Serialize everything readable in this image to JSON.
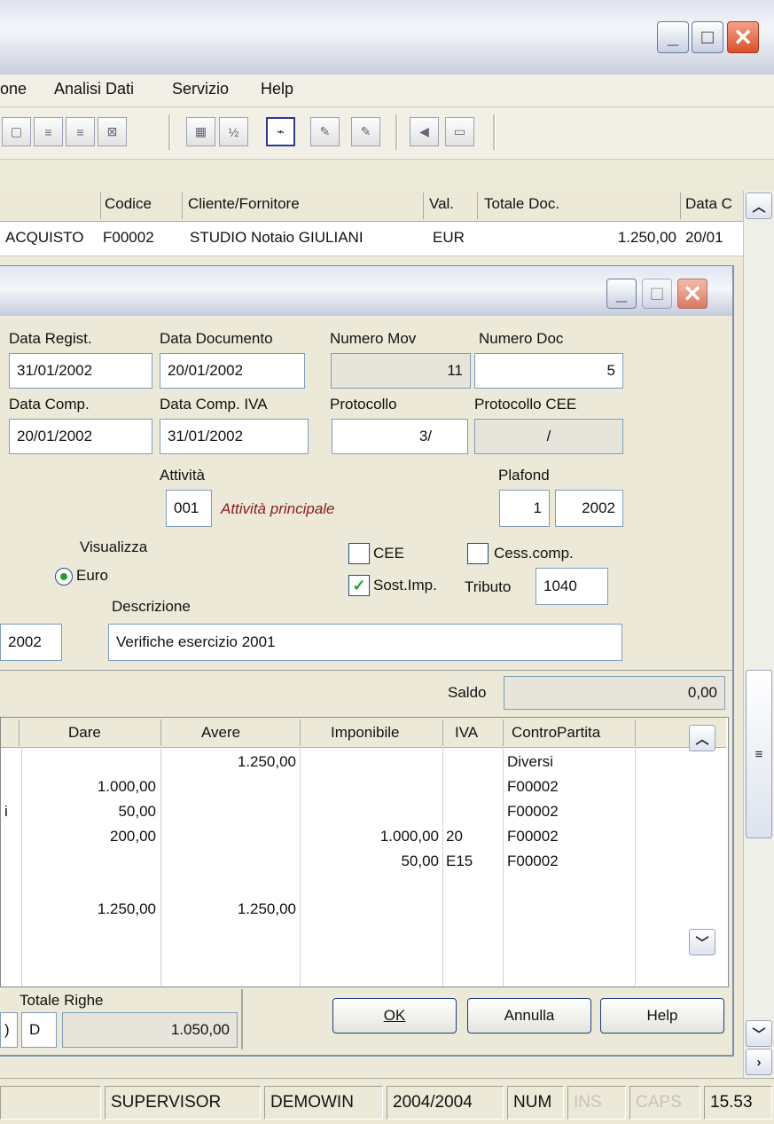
{
  "window": {
    "minimize": "_",
    "maximize": "□",
    "close": "✕"
  },
  "menu": [
    "one",
    "Analisi Dati",
    "Servizio",
    "Help"
  ],
  "grid": {
    "headers": [
      "Codice",
      "Cliente/Fornitore",
      "Val.",
      "Totale Doc.",
      "Data C"
    ],
    "row": {
      "tipo": "ACQUISTO",
      "codice": "F00002",
      "cliente": "STUDIO Notaio GIULIANI",
      "val": "EUR",
      "totale": "1.250,00",
      "data": "20/01"
    }
  },
  "dialog": {
    "labels": {
      "data_regist": "Data Regist.",
      "data_documento": "Data Documento",
      "numero_mov": "Numero Mov",
      "numero_doc": "Numero Doc",
      "data_comp": "Data Comp.",
      "data_comp_iva": "Data Comp. IVA",
      "protocollo": "Protocollo",
      "protocollo_cee": "Protocollo CEE",
      "attivita": "Attività",
      "plafond": "Plafond",
      "visualizza": "Visualizza",
      "euro": "Euro",
      "cee": "CEE",
      "cess_comp": "Cess.comp.",
      "sost_imp": "Sost.Imp.",
      "tributo": "Tributo",
      "descrizione": "Descrizione",
      "saldo": "Saldo"
    },
    "values": {
      "data_regist": "31/01/2002",
      "data_documento": "20/01/2002",
      "numero_mov": "11",
      "numero_doc": "5",
      "data_comp": "20/01/2002",
      "data_comp_iva": "31/01/2002",
      "protocollo": "3/",
      "protocollo_cee": "/",
      "attivita_code": "001",
      "attivita_desc": "Attività principale",
      "plafond_num": "1",
      "plafond_year": "2002",
      "tributo": "1040",
      "year": "2002",
      "descrizione": "Verifiche esercizio 2001",
      "saldo": "0,00",
      "cee_checked": false,
      "cess_checked": false,
      "sost_checked": true
    },
    "details": {
      "headers": [
        "Dare",
        "Avere",
        "Imponibile",
        "IVA",
        "ControPartita"
      ],
      "rows": [
        {
          "lead": "",
          "dare": "",
          "avere": "1.250,00",
          "imp": "",
          "iva": "",
          "cp": "Diversi"
        },
        {
          "lead": "",
          "dare": "1.000,00",
          "avere": "",
          "imp": "",
          "iva": "",
          "cp": "F00002"
        },
        {
          "lead": "i",
          "dare": "50,00",
          "avere": "",
          "imp": "",
          "iva": "",
          "cp": "F00002"
        },
        {
          "lead": "",
          "dare": "200,00",
          "avere": "",
          "imp": "1.000,00",
          "iva": "20",
          "cp": "F00002"
        },
        {
          "lead": "",
          "dare": "",
          "avere": "",
          "imp": "50,00",
          "iva": "E15",
          "cp": "F00002"
        }
      ],
      "totals": {
        "dare": "1.250,00",
        "avere": "1.250,00"
      }
    },
    "footer": {
      "totale_righe_label": "Totale Righe",
      "left_fragment": ")",
      "dc": "D",
      "totale_righe": "1.050,00"
    },
    "buttons": {
      "ok": "OK",
      "annulla": "Annulla",
      "help": "Help"
    }
  },
  "status": [
    "SUPERVISOR",
    "DEMOWIN",
    "2004/2004",
    "NUM",
    "INS",
    "CAPS",
    "15.53"
  ]
}
